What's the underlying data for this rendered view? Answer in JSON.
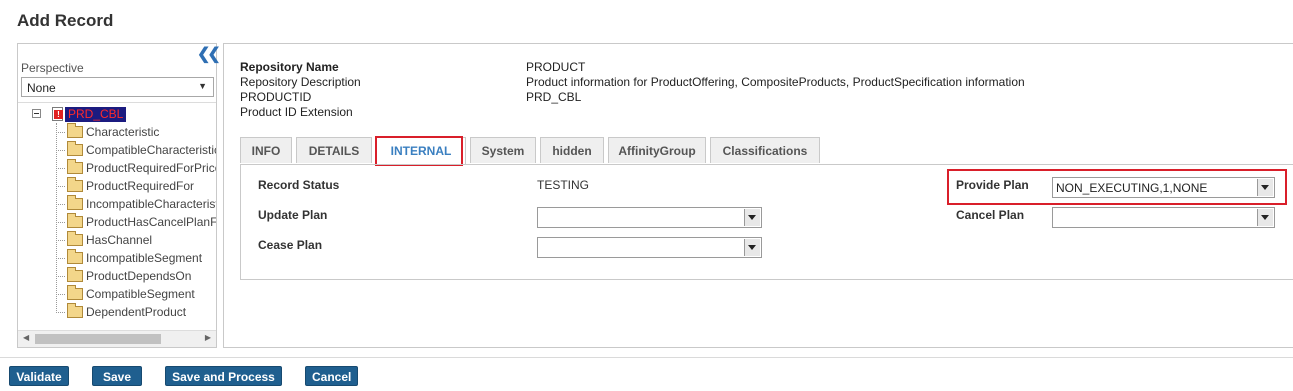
{
  "window": {
    "title": "Add Record"
  },
  "perspective": {
    "label": "Perspective",
    "selected": "None"
  },
  "tree": {
    "root": "PRD_CBL",
    "items": [
      "Characteristic",
      "CompatibleCharacteristic",
      "ProductRequiredForPrice",
      "ProductRequiredFor",
      "IncompatibleCharacteristic",
      "ProductHasCancelPlanF",
      "HasChannel",
      "IncompatibleSegment",
      "ProductDependsOn",
      "CompatibleSegment",
      "DependentProduct"
    ]
  },
  "record_info": {
    "repository_name_label": "Repository Name",
    "repository_name_value": "PRODUCT",
    "repository_description_label": "Repository Description",
    "repository_description_value": "Product information for ProductOffering, CompositeProducts, ProductSpecification information",
    "productid_label": "PRODUCTID",
    "productid_value": "PRD_CBL",
    "product_id_extension_label": "Product ID Extension",
    "product_id_extension_value": ""
  },
  "tabs": [
    "INFO",
    "DETAILS",
    "INTERNAL",
    "System",
    "hidden",
    "AffinityGroup",
    "Classifications"
  ],
  "active_tab": "INTERNAL",
  "internal": {
    "record_status_label": "Record Status",
    "record_status_value": "TESTING",
    "update_plan_label": "Update Plan",
    "update_plan_value": "",
    "cease_plan_label": "Cease Plan",
    "cease_plan_value": "",
    "provide_plan_label": "Provide Plan",
    "provide_plan_value": "NON_EXECUTING,1,NONE",
    "cancel_plan_label": "Cancel Plan",
    "cancel_plan_value": ""
  },
  "actions": {
    "validate": "Validate",
    "save": "Save",
    "save_and_process": "Save and Process",
    "cancel": "Cancel"
  },
  "colors": {
    "button_bg": "#1f5f8f",
    "highlight": "#d91f2a",
    "active_tab_text": "#3a7fc0",
    "tree_root_bg": "#1b1b80",
    "tree_root_text": "#ff2a2a"
  },
  "icons": [
    "collapse-double-left-icon",
    "dropdown-arrow-icon",
    "tree-expand-icon",
    "document-error-icon",
    "folder-icon",
    "scroll-left-icon",
    "scroll-right-icon"
  ]
}
